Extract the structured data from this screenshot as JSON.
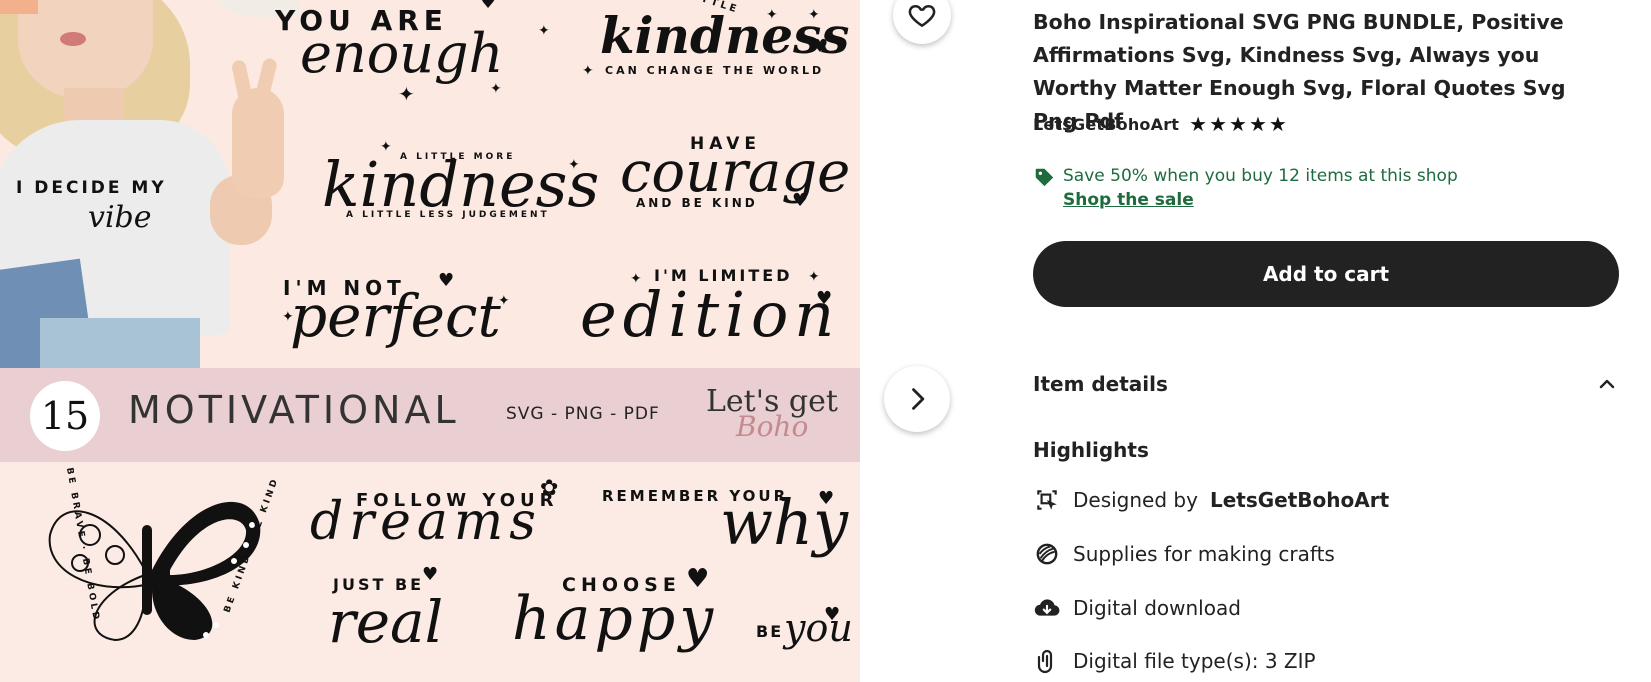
{
  "image": {
    "shirt_line1": "I DECIDE MY",
    "shirt_line2": "vibe",
    "quotes": {
      "you_are": "YOU ARE",
      "enough": "enough",
      "a_little": "A LITTLE",
      "kindness_top": "kindness",
      "change_world": "CAN CHANGE THE WORLD",
      "a_little_more": "A LITTLE MORE",
      "kindness_mid": "kindness",
      "less_judgement": "A LITTLE LESS JUDGEMENT",
      "have": "HAVE",
      "courage": "courage",
      "be_kind": "AND BE KIND",
      "im_not": "I'M NOT",
      "perfect": "perfect",
      "im_limited": "I'M LIMITED",
      "edition": "edition",
      "follow_your": "FOLLOW YOUR",
      "dreams": "dreams",
      "remember_your": "REMEMBER YOUR",
      "why": "why",
      "just_be": "JUST BE",
      "real": "real",
      "choose": "CHOOSE",
      "happy": "happy",
      "be": "BE",
      "you": "you",
      "be_brave": "BE BRAVE · BE BOLD",
      "be_kind_circle": "BE KIND · BE KIND"
    },
    "band": {
      "count": "15",
      "title": "MOTIVATIONAL",
      "formats": "SVG - PNG - PDF",
      "logo_top": "Let's get",
      "logo_bottom": "Boho"
    }
  },
  "listing": {
    "title": "Boho Inspirational SVG PNG BUNDLE, Positive Affirmations Svg, Kindness Svg, Always you Worthy Matter Enough Svg, Floral Quotes Svg Png Pdf",
    "seller": "LetsGetBohoArt",
    "rating": 5,
    "sale_text": "Save 50% when you buy 12 items at this shop",
    "sale_link": "Shop the sale",
    "add_to_cart": "Add to cart",
    "item_details": "Item details",
    "highlights": "Highlights",
    "designed_by_prefix": "Designed by",
    "designed_by_name": "LetsGetBohoArt",
    "supplies": "Supplies for making crafts",
    "digital_download": "Digital download",
    "file_types": "Digital file type(s): 3 ZIP"
  },
  "colors": {
    "sale_green": "#1e6b3e",
    "cart_bg": "#222222",
    "band_pink": "#e9cfd1",
    "image_bg": "#fce9e2"
  },
  "icons": {
    "favorite": "heart-outline-icon",
    "next": "chevron-right-icon",
    "sale": "price-tag-icon",
    "collapse": "chevron-up-icon",
    "designed": "designer-icon",
    "supplies": "yarn-icon",
    "download": "cloud-download-icon",
    "file": "paperclip-icon"
  }
}
